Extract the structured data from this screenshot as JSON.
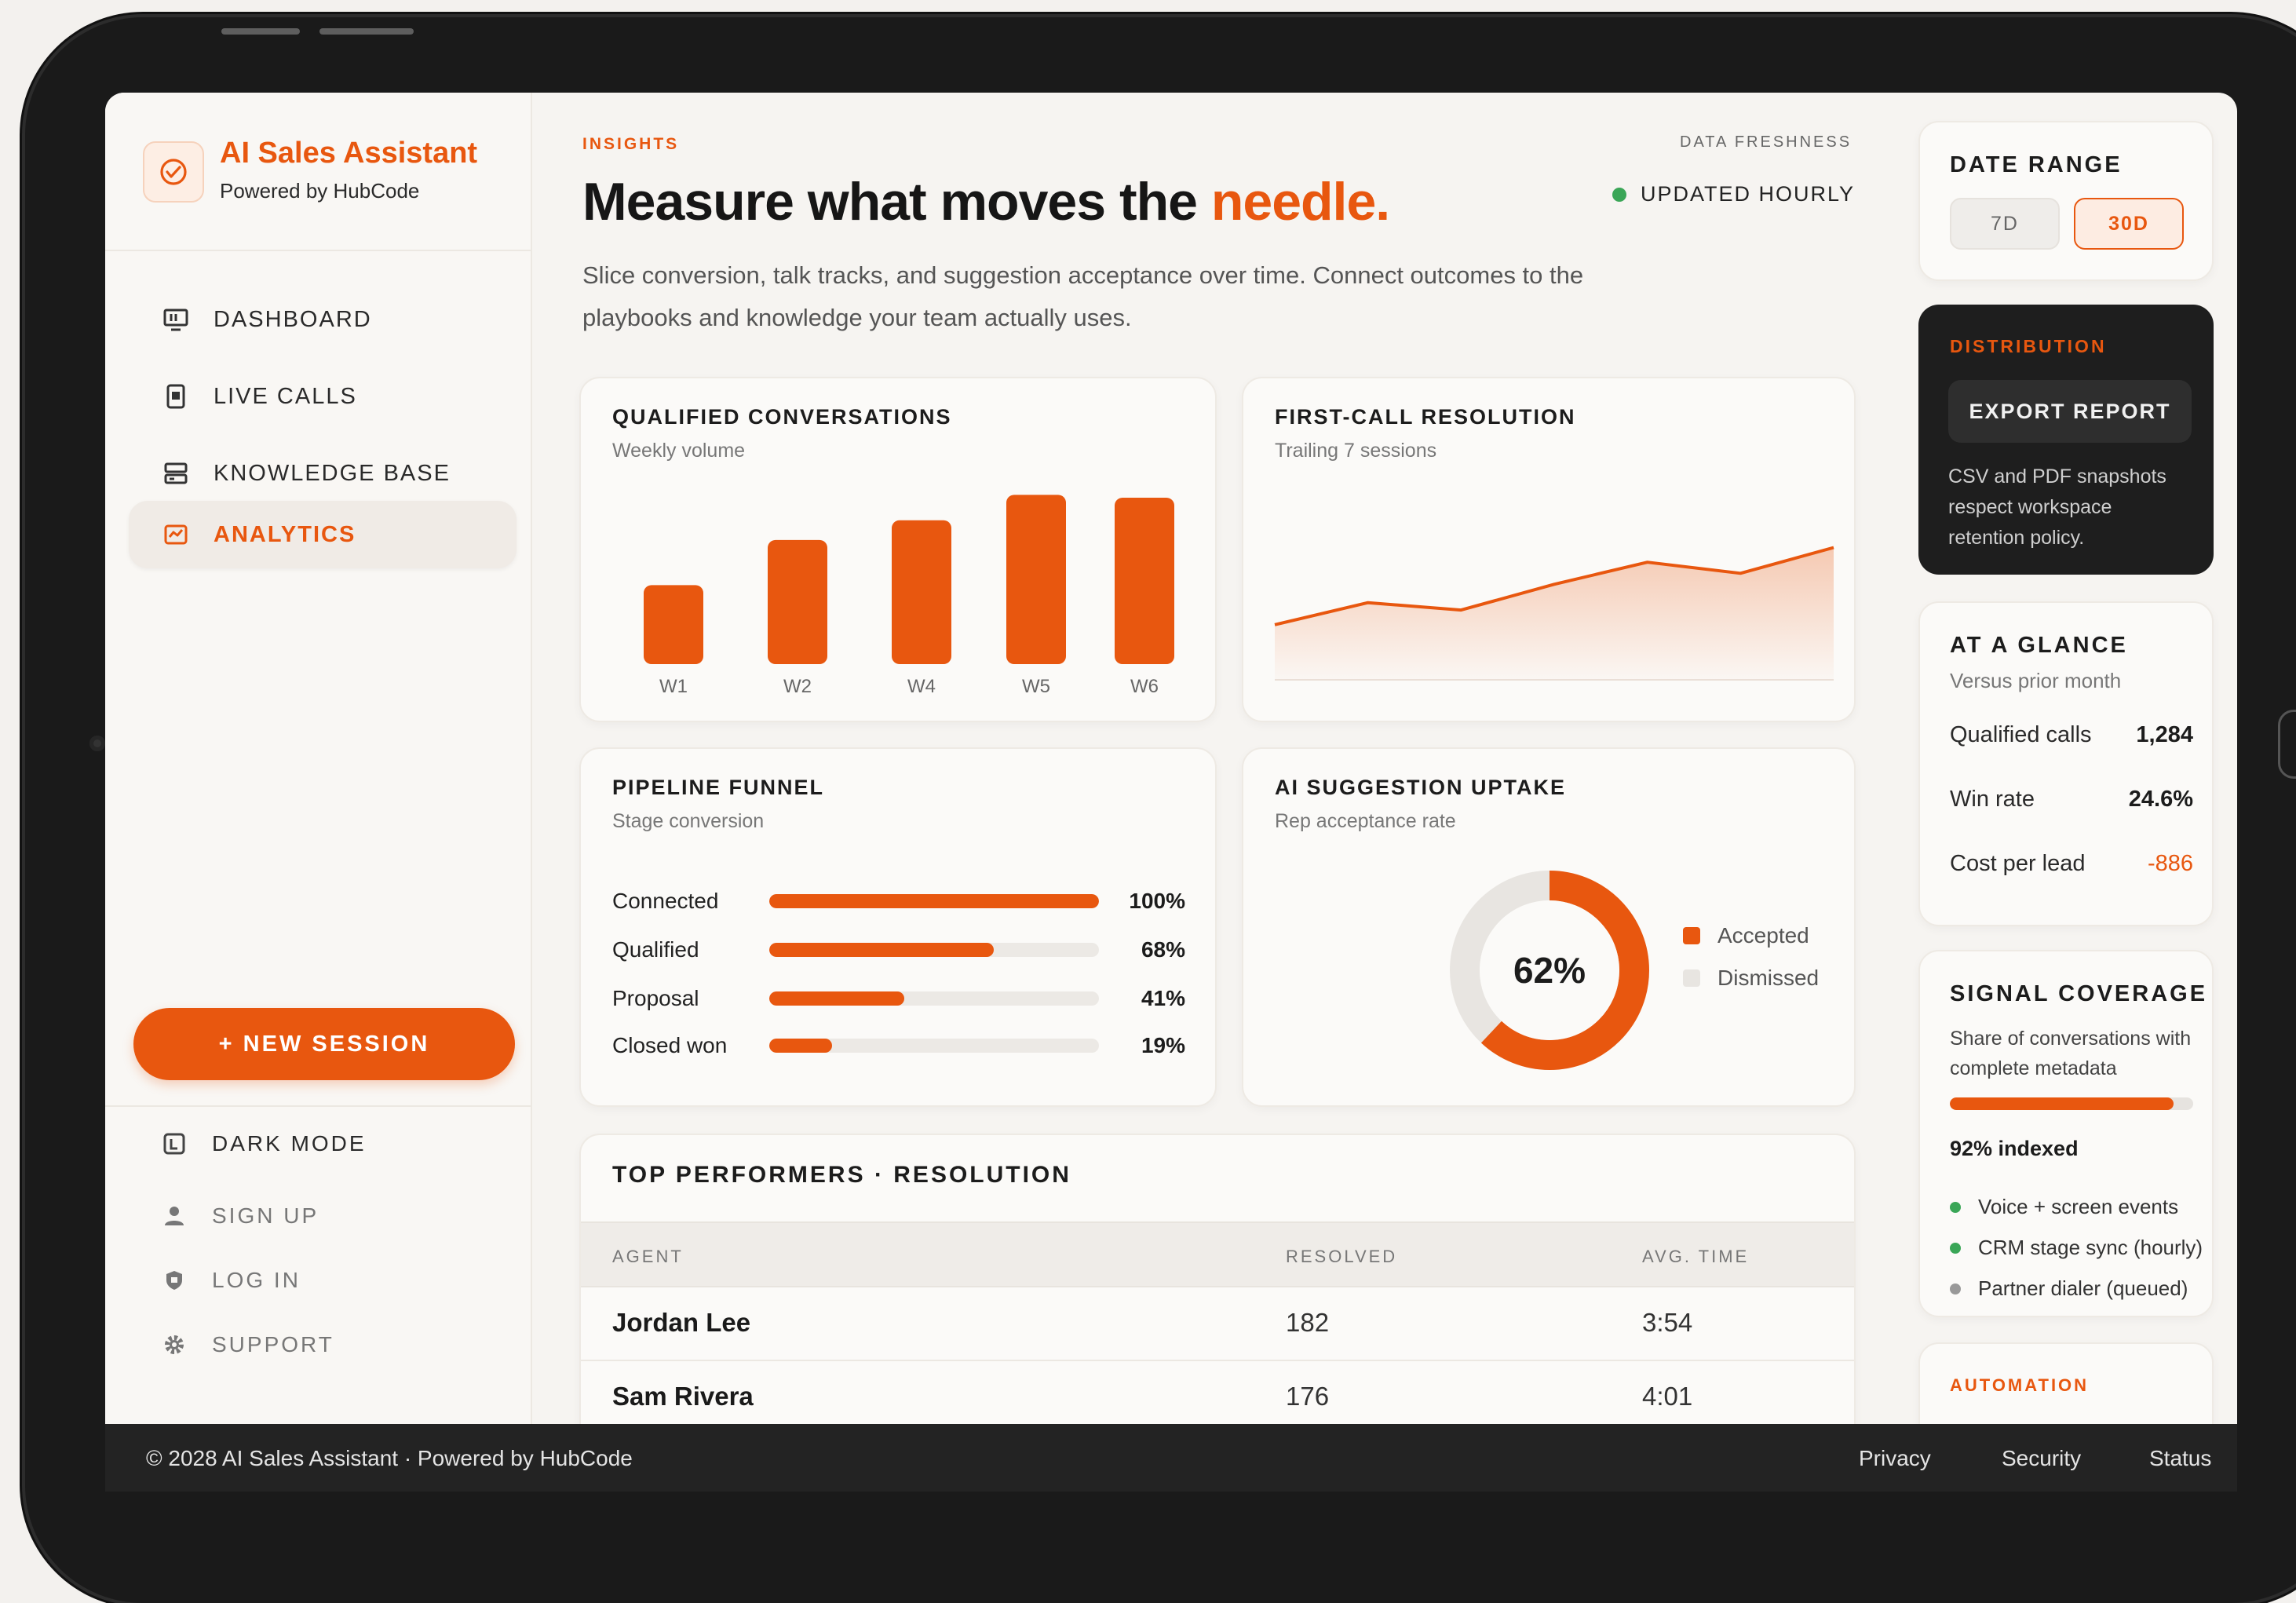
{
  "brand": {
    "title": "AI Sales Assistant",
    "subtitle": "Powered by HubCode"
  },
  "nav": {
    "dashboard": "DASHBOARD",
    "live_calls": "LIVE CALLS",
    "knowledge_base": "KNOWLEDGE BASE",
    "analytics": "ANALYTICS"
  },
  "new_session": "+ NEW SESSION",
  "sidebar_footer": {
    "dark_mode": "DARK MODE",
    "sign_up": "SIGN UP",
    "log_in": "LOG IN",
    "support": "SUPPORT"
  },
  "header": {
    "eyebrow": "INSIGHTS",
    "headline_main": "Measure what moves the ",
    "headline_accent": "needle.",
    "lead": "Slice conversion, talk tracks, and suggestion acceptance over time.    Connect outcomes to the playbooks and knowledge your team actually uses.",
    "freshness_label": "DATA FRESHNESS",
    "freshness_status": "UPDATED HOURLY",
    "status_color": "#3aa657"
  },
  "qualified_conversations": {
    "title": "QUALIFIED CONVERSATIONS",
    "subtitle": "Weekly volume",
    "chart_data": {
      "type": "bar",
      "title": "QUALIFIED CONVERSATIONS",
      "subtitle": "Weekly volume",
      "categories": [
        "W1",
        "W2",
        "W4",
        "W5",
        "W6"
      ],
      "values": [
        28,
        44,
        51,
        60,
        59
      ],
      "ylim": [
        0,
        64
      ],
      "grid": false,
      "color": "#e8570f"
    }
  },
  "first_call_resolution": {
    "title": "FIRST-CALL RESOLUTION",
    "subtitle": "Trailing 7 sessions",
    "chart_data": {
      "type": "area",
      "title": "FIRST-CALL RESOLUTION",
      "subtitle": "Trailing 7 sessions",
      "x": [
        1,
        2,
        3,
        4,
        5,
        6,
        7
      ],
      "values": [
        30,
        42,
        38,
        52,
        64,
        58,
        72
      ],
      "ylim": [
        0,
        100
      ],
      "grid": false,
      "color": "#e8570f"
    }
  },
  "pipeline_funnel": {
    "title": "PIPELINE FUNNEL",
    "subtitle": "Stage conversion",
    "stages": [
      {
        "label": "Connected",
        "value": "100%",
        "fraction": 1.0
      },
      {
        "label": "Qualified",
        "value": "68%",
        "fraction": 0.68
      },
      {
        "label": "Proposal",
        "value": "41%",
        "fraction": 0.41
      },
      {
        "label": "Closed won",
        "value": "19%",
        "fraction": 0.19
      }
    ]
  },
  "ai_suggestion_uptake": {
    "title": "AI SUGGESTION UPTAKE",
    "subtitle": "Rep acceptance rate",
    "center_label": "62%",
    "legend_accepted": "Accepted",
    "legend_dismissed": "Dismissed",
    "chart_data": {
      "type": "pie",
      "title": "AI SUGGESTION UPTAKE",
      "labels": [
        "Accepted",
        "Dismissed"
      ],
      "values": [
        62,
        38
      ],
      "colors": [
        "#e8570f",
        "#e8e5e1"
      ]
    }
  },
  "top_performers": {
    "title": "TOP PERFORMERS · RESOLUTION",
    "columns": [
      "AGENT",
      "RESOLVED",
      "AVG. TIME"
    ],
    "rows": [
      {
        "agent": "Jordan Lee",
        "resolved": "182",
        "avg_time": "3:54"
      },
      {
        "agent": "Sam Rivera",
        "resolved": "176",
        "avg_time": "4:01"
      }
    ]
  },
  "date_range": {
    "title": "DATE RANGE",
    "options": [
      "7D",
      "30D"
    ],
    "selected": "30D"
  },
  "distribution": {
    "eyebrow": "DISTRIBUTION",
    "button": "EXPORT REPORT",
    "text": "CSV and PDF snapshots respect workspace retention policy."
  },
  "at_a_glance": {
    "title": "AT A GLANCE",
    "subtitle": "Versus prior month",
    "rows": [
      {
        "label": "Qualified calls",
        "value": "1,284"
      },
      {
        "label": "Win rate",
        "value": "24.6%"
      },
      {
        "label": "Cost per lead",
        "value": "-886"
      }
    ]
  },
  "signal_coverage": {
    "title": "SIGNAL COVERAGE",
    "subtitle": "Share of conversations with complete metadata",
    "progress": 0.92,
    "progress_label": "92% indexed",
    "items": [
      {
        "label": "Voice + screen events",
        "color": "#3aa657"
      },
      {
        "label": "CRM stage sync (hourly)",
        "color": "#3aa657"
      },
      {
        "label": "Partner dialer (queued)",
        "color": "#999999"
      }
    ]
  },
  "automation": {
    "eyebrow": "AUTOMATION"
  },
  "footer": {
    "copyright": "© 2028 AI Sales Assistant · Powered by HubCode",
    "links": [
      "Privacy",
      "Security",
      "Status"
    ]
  },
  "colors": {
    "accent": "#e8570f",
    "dark": "#1e1e1e",
    "success": "#3aa657"
  }
}
